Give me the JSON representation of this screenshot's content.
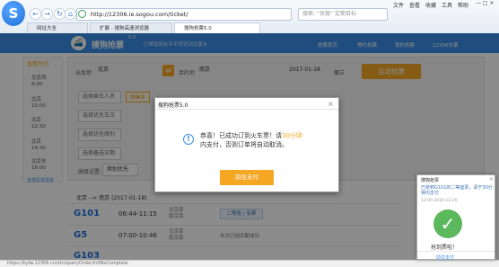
{
  "browser": {
    "logo_letter": "S",
    "back": "←",
    "forward": "→",
    "refresh": "↻",
    "home": "⌂",
    "address": "http://12306.ie.sogou.com/ticket/",
    "search_placeholder": "搜索:  “快搜” 定期目标",
    "menu": [
      "文件",
      "查看",
      "收藏",
      "工具",
      "帮助"
    ],
    "tabs": [
      "网址大全",
      "扩展 - 搜狗高速浏览器",
      "搜狗抢票5.0"
    ]
  },
  "site": {
    "title": "搜狗抢票",
    "badge": "5.0",
    "slogan": "已帮助网友平平安安到达家乡",
    "links": [
      "抢票首页",
      "预约抢票",
      "我的抢票",
      "12306车票"
    ]
  },
  "sidebar": {
    "header": "查看时间",
    "items": [
      {
        "route": "北京西",
        "time": "8:00"
      },
      {
        "route": "北京",
        "time": "10:00"
      },
      {
        "route": "北京",
        "time": "12:30"
      },
      {
        "route": "北京",
        "time": "14:30"
      },
      {
        "route": "北京东",
        "time": "16:00"
      }
    ],
    "footer": "全部车票信息"
  },
  "form": {
    "from_label": "出发地",
    "from_value": "北京",
    "swap_icon": "⇄",
    "to_label": "目的地",
    "to_value": "南京",
    "date_value": "2017-01-18",
    "weekday": "周三",
    "search_button": "自动抢票",
    "passenger_placeholder": "选择乘车人员",
    "passenger_chip": "刘继冲",
    "train_placeholder": "选择优先车次",
    "seat_placeholder": "选择优先席别",
    "backup_date_placeholder": "选择备选日期",
    "advanced_label": "高级设置：",
    "advanced_value": "席别优先"
  },
  "results": {
    "route": "北京 --> 南京 (2017-01-18)",
    "rows": [
      {
        "train": "G101",
        "time": "06:44-11:15",
        "station": "北京南",
        "station2": "南京南",
        "seat": "二等座 | 有票",
        "status": ""
      },
      {
        "train": "G5",
        "time": "07:00-10:46",
        "station": "北京南",
        "station2": "南京南",
        "seat": "",
        "status": "车次已经匹配成功"
      },
      {
        "train": "G103",
        "time": "",
        "station": "",
        "station2": "",
        "seat": "",
        "status": ""
      }
    ]
  },
  "status_bar": "https://kyfw.12306.cn/otn/queryOrder/initNoComplete",
  "dialog": {
    "title": "搜狗抢票5.0",
    "close": "×",
    "info_icon": "!",
    "message_pre": "恭喜！已成功订到火车票！请",
    "message_highlight": "30分钟",
    "message_line2": "内支付，否则订单将自动取消。",
    "button": "前往支付"
  },
  "notification": {
    "title": "搜狗抢票",
    "close": "×",
    "body": "已抢到G101的二等座票，请于30分钟内支付",
    "time": "12:00   2016-12-20",
    "check": "✓",
    "ok_text": "抢到票啦！",
    "link": "前往支付"
  }
}
